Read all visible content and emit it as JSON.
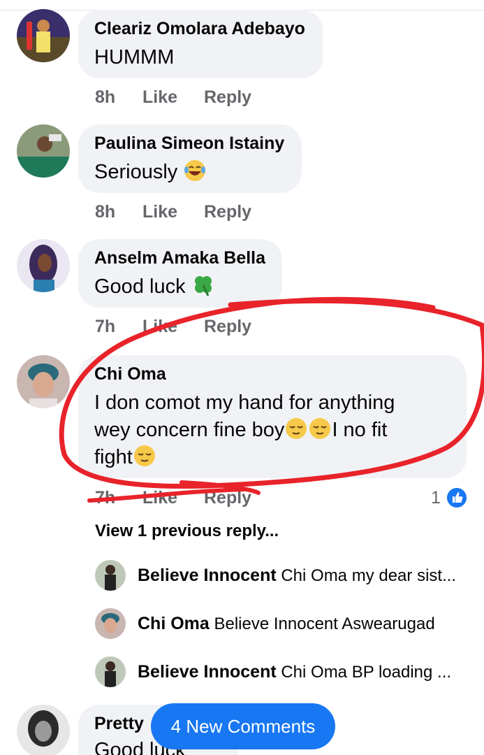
{
  "comments": [
    {
      "author": "Cleariz Omolara Adebayo",
      "text": "HUMMM",
      "time": "8h",
      "like": "Like",
      "reply": "Reply"
    },
    {
      "author": "Paulina Simeon Istainy",
      "text": "Seriously",
      "emoji": "laughing-tears",
      "time": "8h",
      "like": "Like",
      "reply": "Reply"
    },
    {
      "author": "Anselm Amaka Bella",
      "text": "Good luck",
      "emoji": "four-leaf-clover",
      "time": "7h",
      "like": "Like",
      "reply": "Reply"
    },
    {
      "author": "Chi Oma",
      "line1": "I don comot my hand for anything",
      "line2a": "wey concern fine boy",
      "line2b": "I no fit",
      "line3": "fight",
      "emoji": "relieved-face",
      "time": "7h",
      "like": "Like",
      "reply": "Reply",
      "reaction_count": "1",
      "reaction_icon": "like-icon"
    }
  ],
  "view_previous": "View 1 previous reply...",
  "replies": [
    {
      "author": "Believe Innocent",
      "text": "Chi Oma  my dear sist..."
    },
    {
      "author": "Chi Oma",
      "text": "Believe Innocent Aswearugad"
    },
    {
      "author": "Believe Innocent",
      "text": "Chi Oma  BP loading ..."
    }
  ],
  "partial_comment": {
    "author": "Pretty",
    "text": "Good luck"
  },
  "new_comments_label": "4 New Comments",
  "colors": {
    "accent": "#1877f2",
    "bubble": "#f0f2f5",
    "meta": "#65676b",
    "annotation": "#e8232a"
  }
}
